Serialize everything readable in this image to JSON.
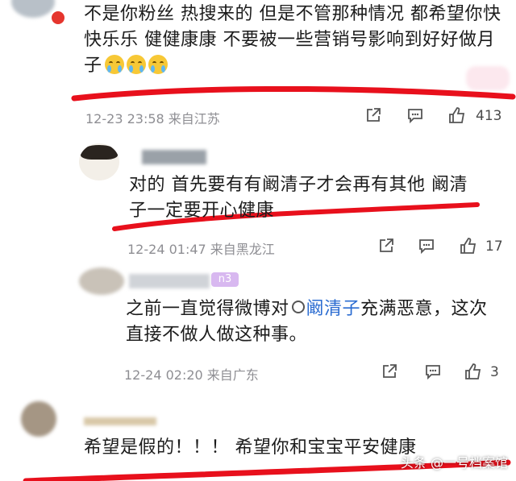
{
  "comments": [
    {
      "text": "不是你粉丝 热搜来的 但是不管那种情况 都希望你快快乐乐 健健康康 不要被一些营销号影响到好好做月子",
      "time": "12-23 23:58",
      "source": "来自江苏",
      "likes": "413"
    },
    {
      "text": "对的 首先要有有阚清子才会再有其他 阚清子一定要开心健康",
      "time": "12-24 01:47",
      "source": "来自黑龙江",
      "likes": "17"
    },
    {
      "text_before": "之前一直觉得微博对",
      "mention": "阚清子",
      "text_after": "充满恶意，这次直接不做人做这种事。",
      "time": "12-24 02:20",
      "source": "来自广东",
      "likes": "3",
      "badge": "n3"
    },
    {
      "text": "希望是假的！！！ 希望你和宝宝平安健康"
    }
  ],
  "watermark": "头条 @一号档案馆",
  "colors": {
    "accent_red": "#e8101c",
    "mention": "#2b6cd1",
    "meta": "#8e8e93"
  }
}
